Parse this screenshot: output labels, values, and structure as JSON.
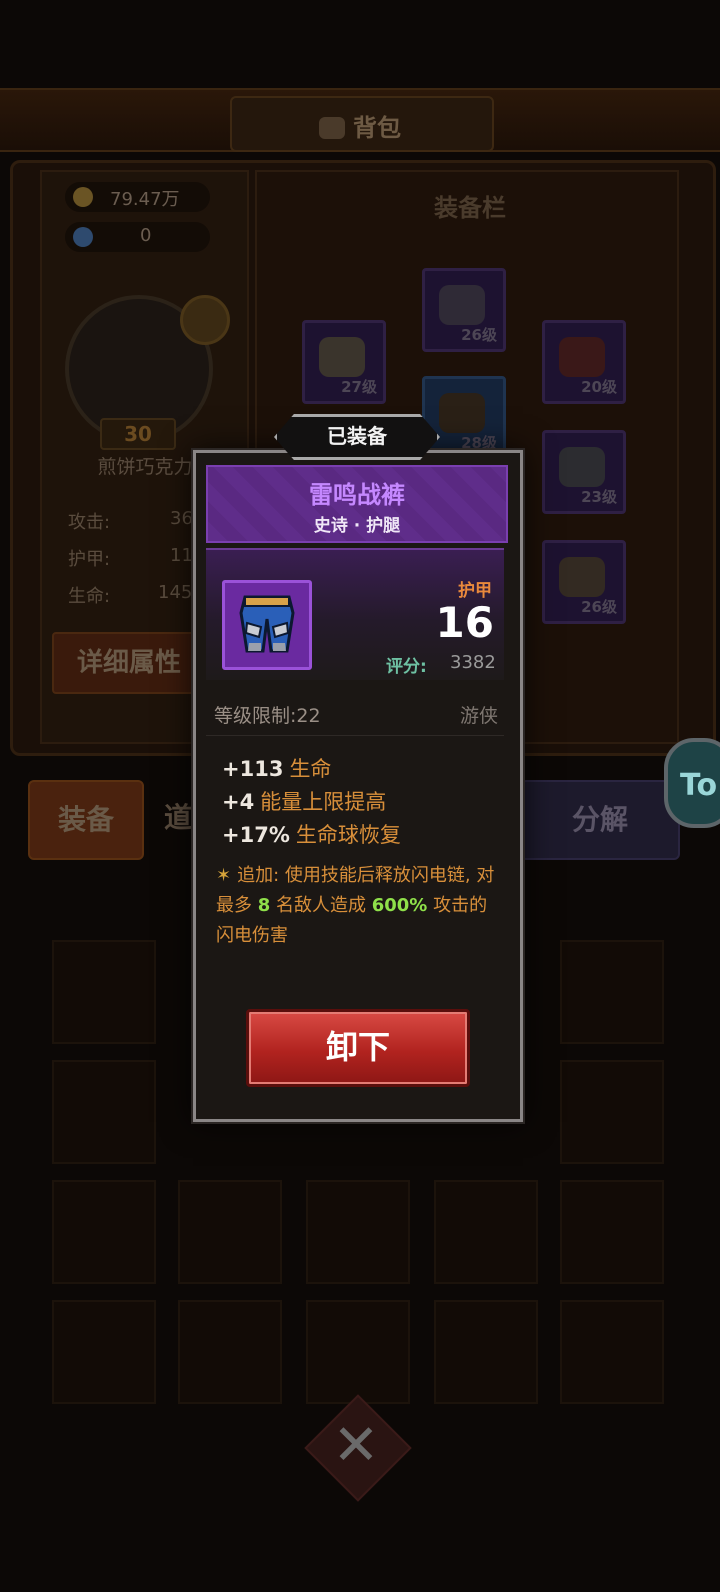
{
  "header": {
    "title": "背包"
  },
  "resources": {
    "gold": "79.47万",
    "gems": "0"
  },
  "player": {
    "level": "30",
    "name": "煎饼巧克力"
  },
  "stats": [
    {
      "label": "攻击:",
      "value": "36"
    },
    {
      "label": "护甲:",
      "value": "11"
    },
    {
      "label": "生命:",
      "value": "145"
    }
  ],
  "buttons": {
    "detail": "详细属性",
    "equip_tab": "装备",
    "item_tab": "道",
    "decompose": "分解"
  },
  "equipment_bar": {
    "title": "装备栏",
    "slots": [
      {
        "level": "26级",
        "icon": "wings-icon"
      },
      {
        "level": "27级",
        "icon": "helmet-icon"
      },
      {
        "level": "20级",
        "icon": "amulet-icon"
      },
      {
        "level": "28级",
        "icon": "armor-icon"
      },
      {
        "level": "23级",
        "icon": "ring-icon"
      },
      {
        "level": "26级",
        "icon": "gauntlet-icon"
      }
    ]
  },
  "side_badge": "To",
  "popup": {
    "status_tag": "已装备",
    "item_name": "雷鸣战裤",
    "item_subtitle": "史诗 · 护腿",
    "main_stat_label": "护甲",
    "main_stat_value": "16",
    "score_label": "评分:",
    "score_value": "3382",
    "level_limit_label": "等级限制:",
    "level_limit_value": "22",
    "class": "游侠",
    "attributes": [
      {
        "value": "+113",
        "name": "生命"
      },
      {
        "value": "+4",
        "name": "能量上限提高"
      },
      {
        "value": "+17%",
        "name": "生命球恢复"
      }
    ],
    "bonus": {
      "prefix": "追加: 使用技能后释放闪电链, 对最多",
      "targets": "8",
      "middle": "名敌人造成",
      "percent": "600%",
      "suffix": "攻击的闪电伤害"
    },
    "unequip_label": "卸下"
  },
  "colors": {
    "epic_purple": "#c588ff",
    "stat_orange": "#d88f3a",
    "highlight_green": "#8fe04a",
    "button_red": "#b1231f"
  }
}
